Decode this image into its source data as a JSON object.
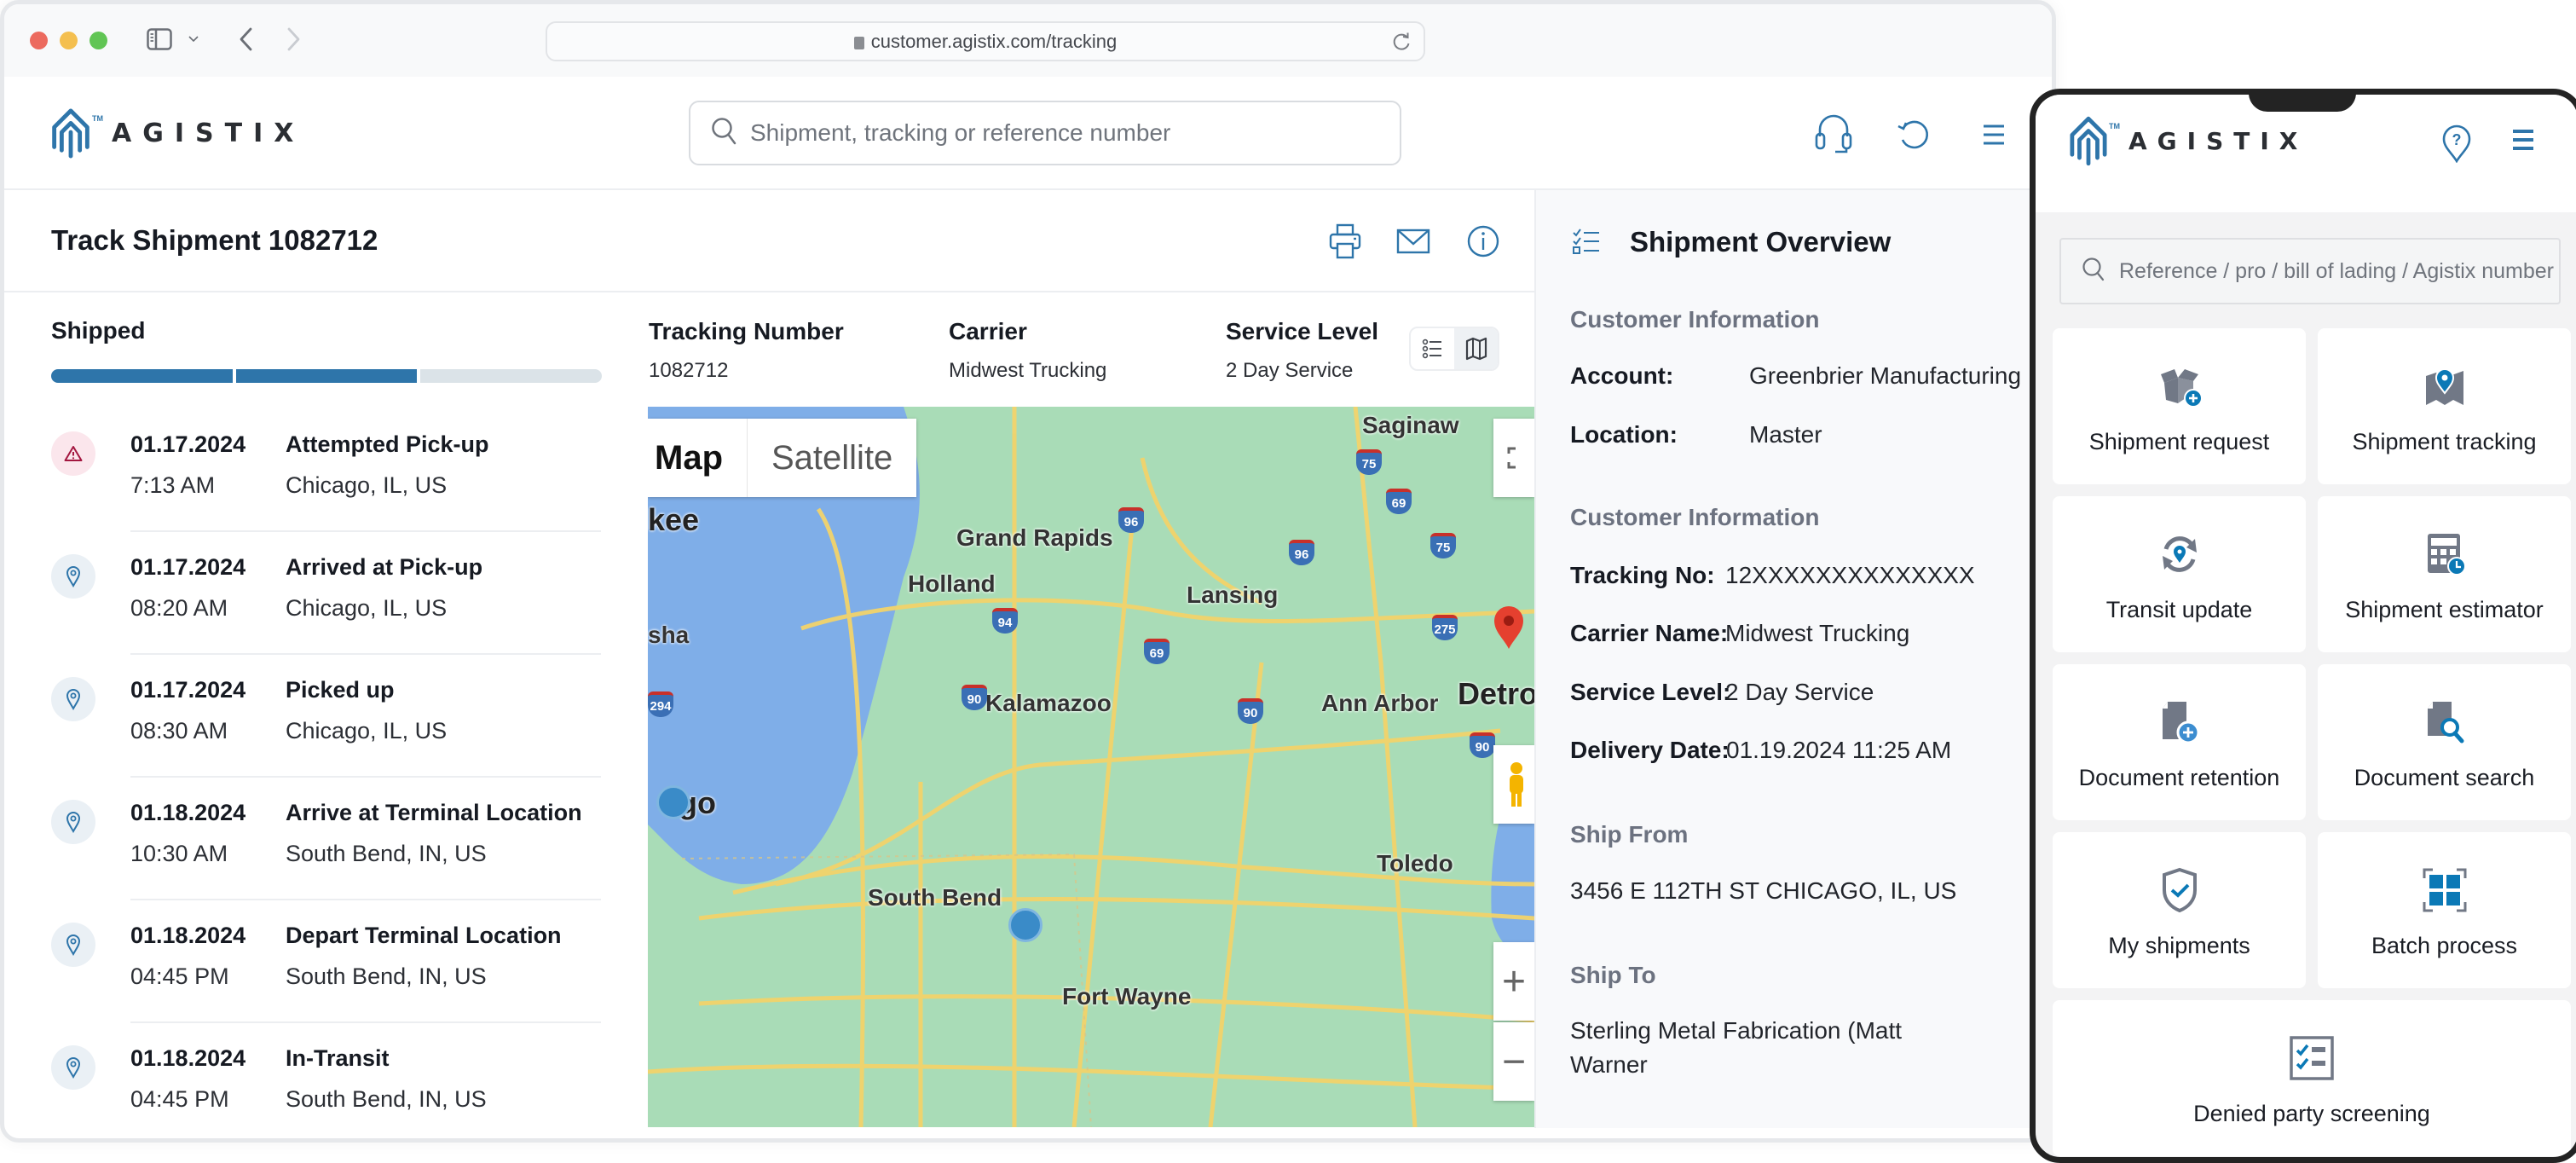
{
  "browser": {
    "url": "customer.agistix.com/tracking"
  },
  "header": {
    "logo_text": "AGISTIX",
    "logo_tm": "TM",
    "search_placeholder": "Shipment, tracking or reference number",
    "icons": [
      "headset-icon",
      "history-icon",
      "menu-icon"
    ]
  },
  "page": {
    "title": "Track Shipment 1082712",
    "actions": [
      "print-icon",
      "mail-icon",
      "info-icon"
    ]
  },
  "status": {
    "label": "Shipped",
    "progress": {
      "steps_total": 3,
      "steps_completed": 2
    },
    "accent_color": "#2e75aa"
  },
  "events": [
    {
      "date": "01.17.2024",
      "time": "7:13 AM",
      "title": "Attempted Pick-up",
      "location": "Chicago, IL, US",
      "icon": "warning-icon",
      "type": "warning"
    },
    {
      "date": "01.17.2024",
      "time": "08:20 AM",
      "title": "Arrived at Pick-up",
      "location": "Chicago, IL, US",
      "icon": "location-pin-icon",
      "type": "normal"
    },
    {
      "date": "01.17.2024",
      "time": "08:30 AM",
      "title": "Picked up",
      "location": "Chicago, IL, US",
      "icon": "location-pin-icon",
      "type": "normal"
    },
    {
      "date": "01.18.2024",
      "time": "10:30 AM",
      "title": "Arrive at Terminal Location",
      "location": "South Bend, IN, US",
      "icon": "location-pin-icon",
      "type": "normal"
    },
    {
      "date": "01.18.2024",
      "time": "04:45 PM",
      "title": "Depart Terminal Location",
      "location": "South Bend, IN, US",
      "icon": "location-pin-icon",
      "type": "normal"
    },
    {
      "date": "01.18.2024",
      "time": "04:45 PM",
      "title": "In-Transit",
      "location": "South Bend, IN, US",
      "icon": "location-pin-icon",
      "type": "normal"
    }
  ],
  "tracking": {
    "tracking_number_label": "Tracking Number",
    "tracking_number": "1082712",
    "carrier_label": "Carrier",
    "carrier": "Midwest Trucking",
    "service_label": "Service Level",
    "service": "2 Day Service",
    "view_toggle": [
      "list-view-icon",
      "map-view-icon"
    ],
    "active_view": "map"
  },
  "map": {
    "types": [
      "Map",
      "Satellite"
    ],
    "active_type": "Map",
    "cities": [
      "Saginaw",
      "kee",
      "Grand Rapids",
      "Holland",
      "Lansing",
      "sha",
      "Kalamazoo",
      "Ann Arbor",
      "Detro",
      "go",
      "Toledo",
      "South Bend",
      "Fort Wayne"
    ],
    "highways": [
      "75",
      "69",
      "96",
      "96",
      "75",
      "94",
      "275",
      "69",
      "90",
      "90",
      "90",
      "294"
    ],
    "controls": [
      "fullscreen",
      "pegman",
      "zoom-in",
      "zoom-out"
    ],
    "zoom_in_label": "+",
    "zoom_out_label": "−"
  },
  "overview": {
    "title": "Shipment Overview",
    "sections": {
      "customer1_title": "Customer Information",
      "account_label": "Account:",
      "account": "Greenbrier Manufacturing",
      "location_label": "Location:",
      "location": "Master",
      "customer2_title": "Customer Information",
      "tracking_no_label": "Tracking No:",
      "tracking_no": "12XXXXXXXXXXXXXX",
      "carrier_name_label": "Carrier Name:",
      "carrier_name": "Midwest Trucking",
      "service_level_label": "Service Level:",
      "service_level": "2 Day Service",
      "delivery_date_label": "Delivery Date:",
      "delivery_date": "01.19.2024 11:25 AM",
      "ship_from_title": "Ship From",
      "ship_from": "3456 E 112TH ST CHICAGO, IL, US",
      "ship_to_title": "Ship To",
      "ship_to": "Sterling Metal Fabrication (Matt Warner"
    }
  },
  "mobile": {
    "logo_text": "AGISTIX",
    "logo_tm": "TM",
    "search_placeholder": "Reference / pro / bill of lading / Agistix number",
    "tiles": [
      {
        "label": "Shipment request",
        "icon": "box-add-icon"
      },
      {
        "label": "Shipment tracking",
        "icon": "map-pin-icon"
      },
      {
        "label": "Transit update",
        "icon": "refresh-pin-icon"
      },
      {
        "label": "Shipment estimator",
        "icon": "calculator-clock-icon"
      },
      {
        "label": "Document retention",
        "icon": "document-add-icon"
      },
      {
        "label": "Document search",
        "icon": "document-search-icon"
      },
      {
        "label": "My shipments",
        "icon": "shield-check-icon"
      },
      {
        "label": "Batch process",
        "icon": "batch-grid-icon"
      },
      {
        "label": "Denied party screening",
        "icon": "checklist-icon"
      }
    ]
  }
}
